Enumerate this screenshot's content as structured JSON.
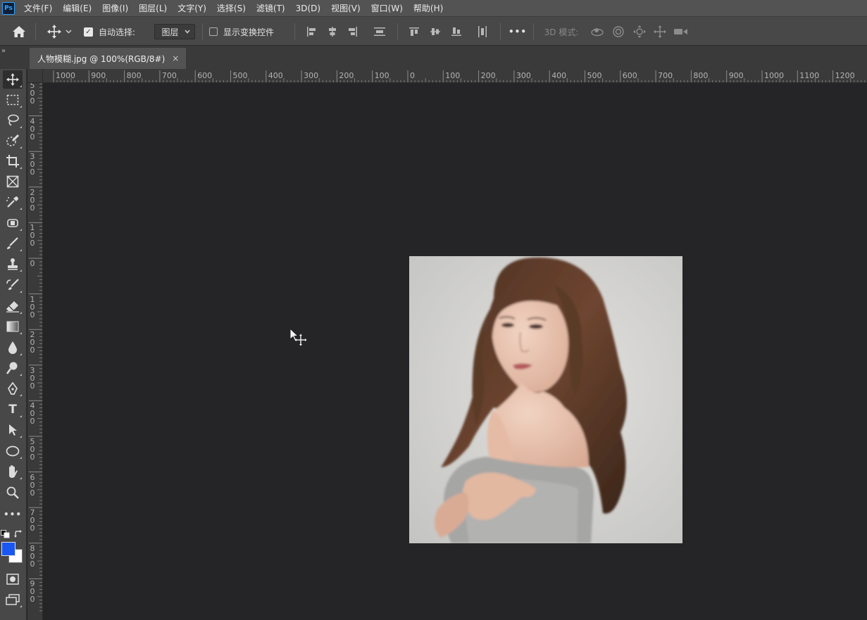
{
  "app": {
    "logo": "Ps"
  },
  "menu": [
    "文件(F)",
    "编辑(E)",
    "图像(I)",
    "图层(L)",
    "文字(Y)",
    "选择(S)",
    "滤镜(T)",
    "3D(D)",
    "视图(V)",
    "窗口(W)",
    "帮助(H)"
  ],
  "options": {
    "auto_select_label": "自动选择:",
    "auto_select_checked": true,
    "auto_select_target": "图层",
    "show_transform_label": "显示变换控件",
    "show_transform_checked": false,
    "more_label": "•••",
    "mode_3d_label": "3D 模式:"
  },
  "document_tab": {
    "title": "人物模糊.jpg @ 100%(RGB/8#)",
    "close": "×"
  },
  "panel_collapse": "»",
  "ruler": {
    "top_labels": [
      "1000",
      "900",
      "800",
      "700",
      "600",
      "500",
      "400",
      "300",
      "200",
      "100",
      "0",
      "100",
      "200",
      "300",
      "400",
      "500",
      "600",
      "700",
      "800",
      "900",
      "1000",
      "1100",
      "1200"
    ],
    "left_labels": [
      "500",
      "400",
      "300",
      "200",
      "100",
      "0",
      "100",
      "200",
      "300",
      "400",
      "500",
      "600",
      "700",
      "800",
      "900"
    ]
  },
  "tools": {
    "type_glyph": "T",
    "more_glyph": "•••"
  },
  "colors": {
    "foreground": "#1a56f0",
    "background": "#ffffff",
    "accent": "#31a8ff",
    "canvas_bg": "#252527"
  },
  "icons": [
    "home-icon",
    "move-icon",
    "chevron-down-icon",
    "align-left-icon",
    "align-center-icon",
    "align-right-icon",
    "distribute-icon",
    "align-top-icon",
    "align-middle-icon",
    "align-bottom-icon",
    "distribute-vertical-icon",
    "orbit-3d-icon",
    "roll-3d-icon",
    "pan-3d-icon",
    "slide-3d-icon",
    "scale-3d-icon",
    "marquee-icon",
    "lasso-icon",
    "quick-select-icon",
    "crop-icon",
    "frame-icon",
    "eyedropper-icon",
    "healing-brush-icon",
    "brush-icon",
    "clone-stamp-icon",
    "history-brush-icon",
    "eraser-icon",
    "gradient-icon",
    "blur-icon",
    "dodge-icon",
    "pen-icon",
    "type-icon",
    "path-select-icon",
    "ellipse-icon",
    "hand-icon",
    "zoom-icon",
    "more-tools-icon",
    "default-colors-icon",
    "swap-colors-icon",
    "quick-mask-icon",
    "screen-mode-icon",
    "move-cursor-icon"
  ]
}
